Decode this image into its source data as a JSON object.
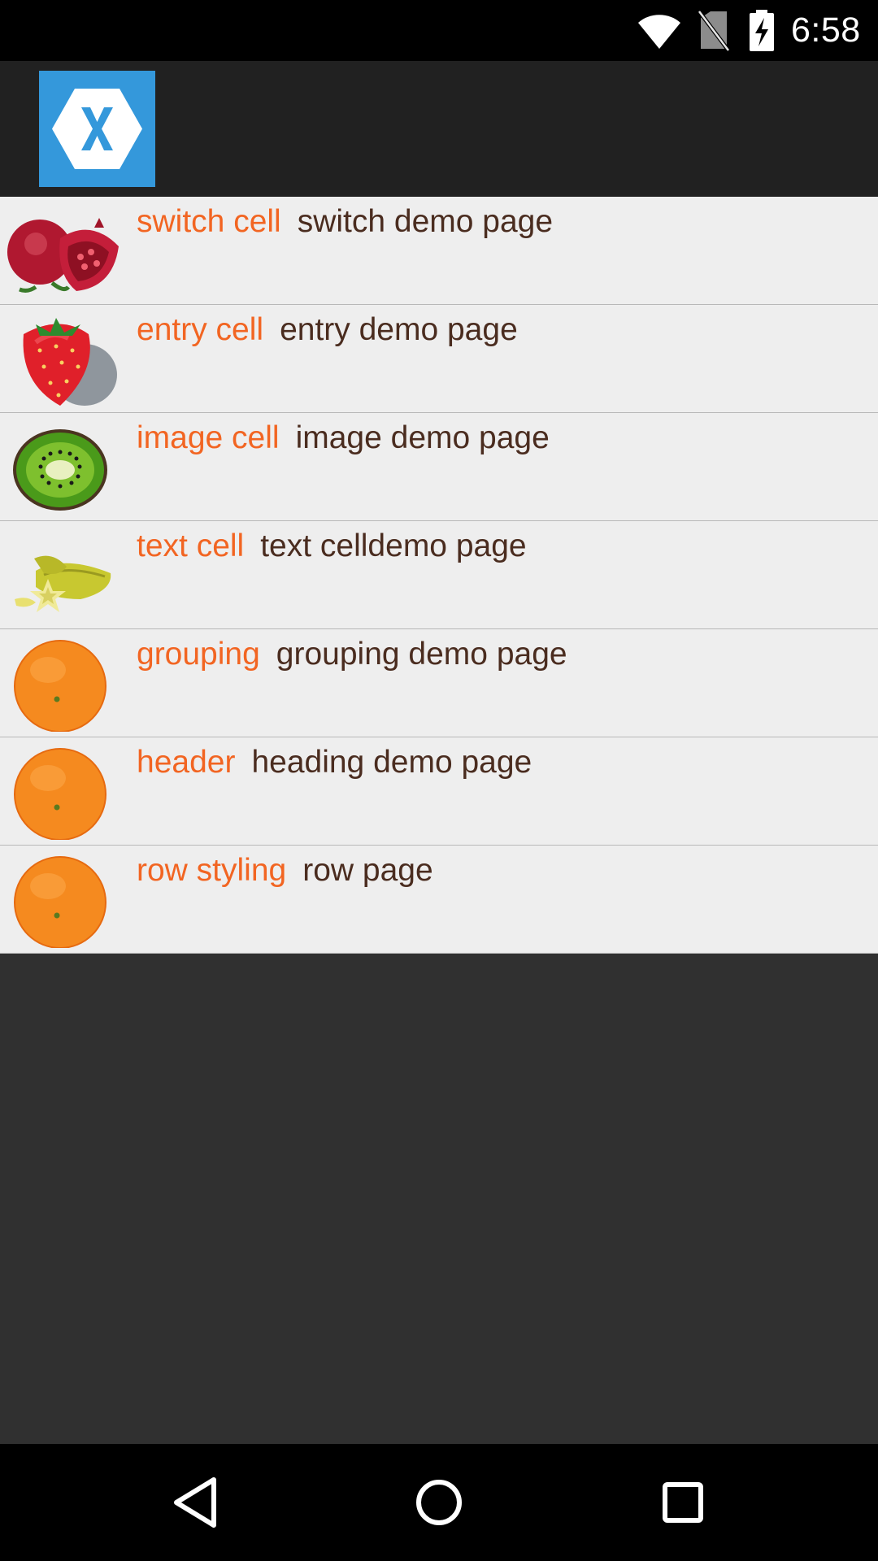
{
  "status_bar": {
    "time": "6:58",
    "icons": [
      "wifi-icon",
      "no-sim-icon",
      "battery-charging-icon"
    ]
  },
  "app_bar": {
    "logo_icon": "xamarin-logo",
    "logo_color": "#3498db"
  },
  "list": {
    "items": [
      {
        "title": "switch cell",
        "detail": "switch demo page",
        "image": "pomegranate-image"
      },
      {
        "title": "entry cell",
        "detail": "entry demo page",
        "image": "strawberry-image"
      },
      {
        "title": "image cell",
        "detail": "image demo page",
        "image": "kiwi-image"
      },
      {
        "title": "text cell",
        "detail": "text celldemo page",
        "image": "starfruit-image"
      },
      {
        "title": "grouping",
        "detail": "grouping demo page",
        "image": "orange-image"
      },
      {
        "title": "header",
        "detail": "heading demo page",
        "image": "orange-image"
      },
      {
        "title": "row styling",
        "detail": "row page",
        "image": "orange-image"
      }
    ]
  },
  "nav_bar": {
    "icons": [
      "back-icon",
      "home-icon",
      "recents-icon"
    ]
  },
  "colors": {
    "title_text": "#f26522",
    "detail_text": "#4a2c1f",
    "list_background": "#eeeeee",
    "app_bar": "#212121",
    "page_background": "#303030"
  }
}
